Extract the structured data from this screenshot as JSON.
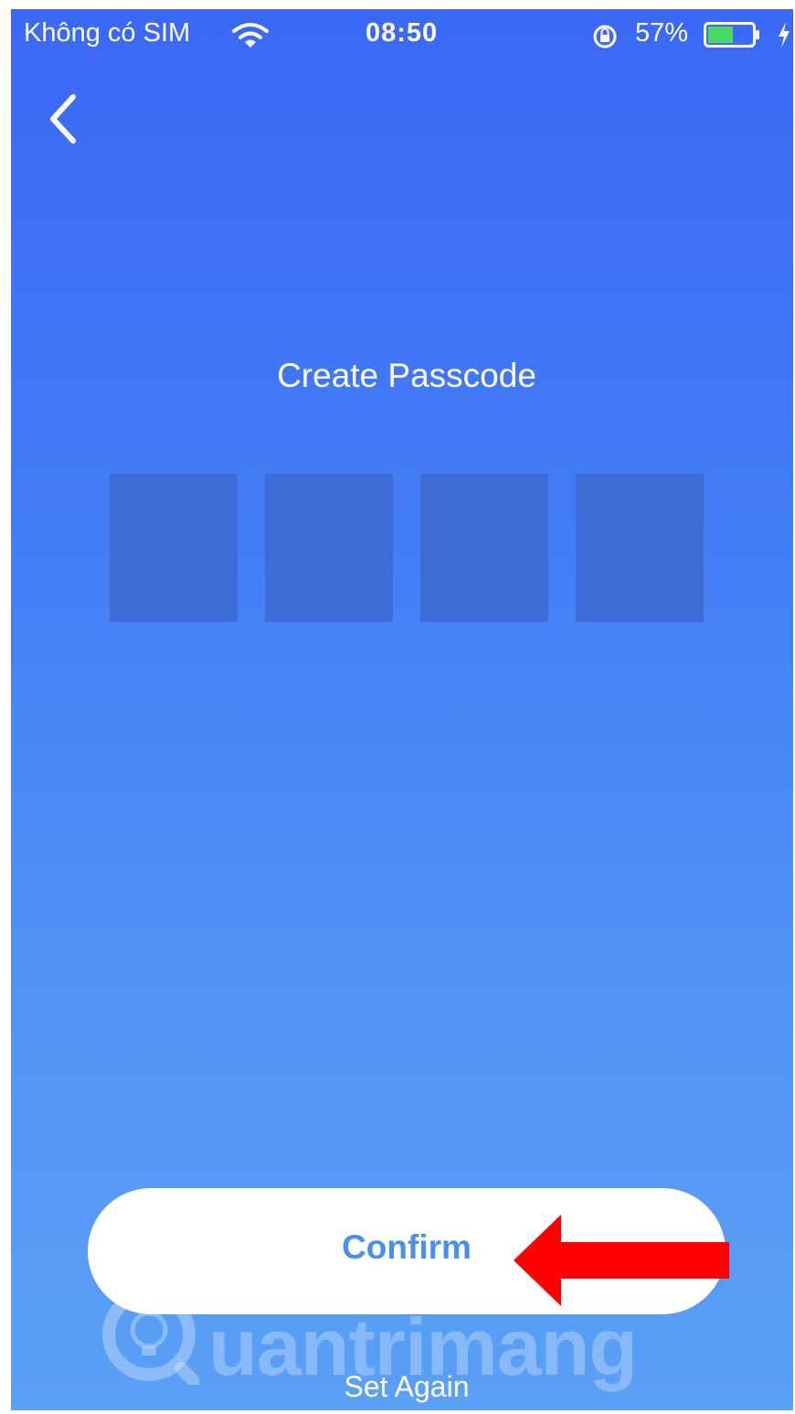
{
  "status_bar": {
    "carrier": "Không có SIM",
    "time": "08:50",
    "battery_percent": "57%",
    "battery_level": 0.57,
    "battery_color": "#4cd964"
  },
  "header": {
    "back_icon": "chevron-left-icon"
  },
  "main": {
    "title": "Create Passcode",
    "passcode_length": 4,
    "digits_entered": 0
  },
  "actions": {
    "confirm_label": "Confirm",
    "set_again_label": "Set Again"
  },
  "watermark": {
    "text": "Quantrimang"
  },
  "colors": {
    "background_top": "#3b68f5",
    "background_bottom": "#5aa0f5",
    "passcode_box": "#3d6cd6",
    "confirm_text": "#4a90e8",
    "annotation_arrow": "#ff0000"
  }
}
